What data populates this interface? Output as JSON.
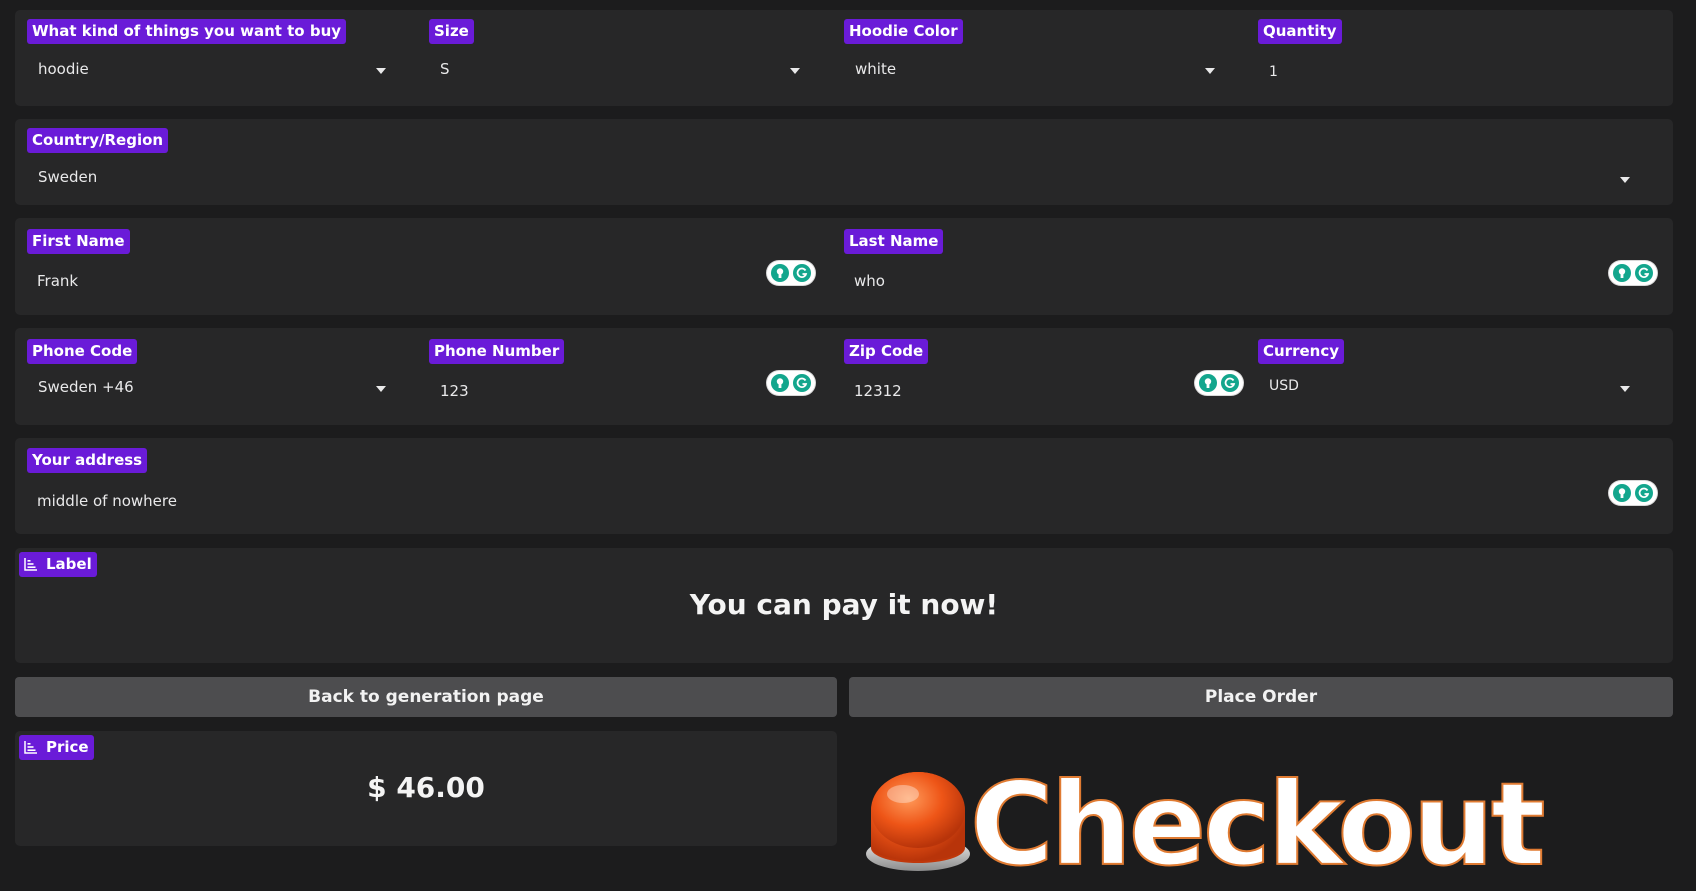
{
  "row1": {
    "item_type": {
      "label": "What kind of things you want to buy",
      "value": "hoodie"
    },
    "size": {
      "label": "Size",
      "value": "S"
    },
    "color": {
      "label": "Hoodie Color",
      "value": "white"
    },
    "quantity": {
      "label": "Quantity",
      "value": "1"
    }
  },
  "country": {
    "label": "Country/Region",
    "value": "Sweden"
  },
  "names": {
    "first": {
      "label": "First Name",
      "value": "Frank"
    },
    "last": {
      "label": "Last Name",
      "value": "who"
    }
  },
  "row4": {
    "phone_code": {
      "label": "Phone Code",
      "value": "Sweden +46"
    },
    "phone_number": {
      "label": "Phone Number",
      "value": "123"
    },
    "zip": {
      "label": "Zip Code",
      "value": "12312"
    },
    "currency": {
      "label": "Currency",
      "value": "USD"
    }
  },
  "address": {
    "label": "Your address",
    "value": "middle of nowhere"
  },
  "status": {
    "label": "Label",
    "message": "You can pay it now!"
  },
  "buttons": {
    "back": "Back to generation page",
    "place_order": "Place Order"
  },
  "price": {
    "label": "Price",
    "value": "$ 46.00"
  },
  "checkout": {
    "text": "Checkout"
  },
  "icons": {
    "dropdown": "chevron-down-icon",
    "grammarly": "grammarly-icon",
    "label_chip": "bar-chart-icon"
  },
  "colors": {
    "background": "#1c1c1d",
    "panel": "#272728",
    "label_chip": "#6a1bd8",
    "button": "#4d4d4f",
    "grammarly": "#13a68d",
    "checkout_button": "#e8511c"
  }
}
